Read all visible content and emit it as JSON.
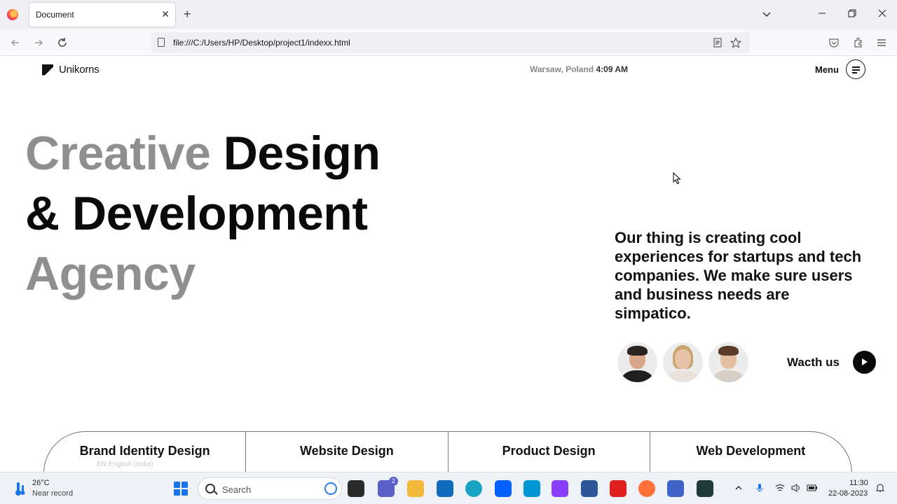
{
  "browser": {
    "tab_title": "Document",
    "tab_close": "✕",
    "new_tab": "+",
    "url": "file:///C:/Users/HP/Desktop/project1/indexx.html"
  },
  "site": {
    "logo_text": "Unikorns",
    "location": "Warsaw, Poland",
    "time": "4:09 AM",
    "menu_label": "Menu",
    "hero": {
      "line1_grey": "Creative",
      "line1_black": "Design",
      "line2": "& Development",
      "line3": "Agency"
    },
    "tagline": "Our thing is creating cool experiences for startups and tech companies. We make sure users and business needs are simpatico.",
    "watch_label": "Wacth us",
    "services": [
      "Brand Identity Design",
      "Website Design",
      "Product Design",
      "Web Development"
    ],
    "lang_hint": "EN English (India)"
  },
  "taskbar": {
    "weather_temp": "26°C",
    "weather_desc": "Near record",
    "search_label": "Search",
    "teams_badge": "2",
    "clock_time": "11:30",
    "clock_date": "22-08-2023"
  },
  "colors": {
    "hero_grey": "#8f8f8f",
    "text_dark": "#111111",
    "accent_blue": "#1a73e8"
  }
}
